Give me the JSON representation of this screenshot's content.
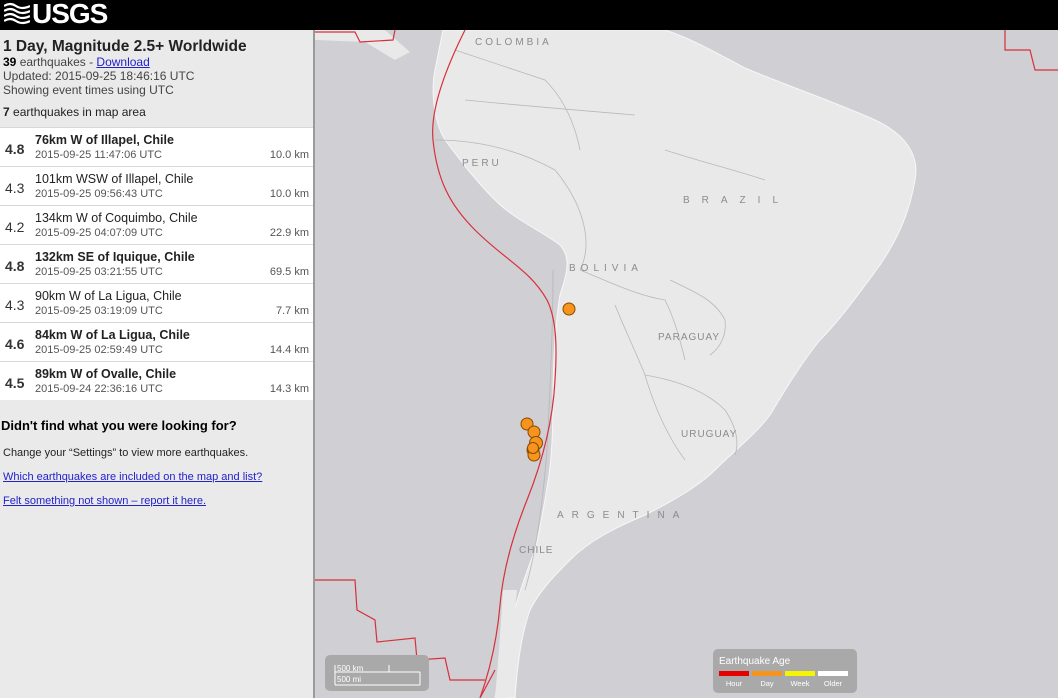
{
  "header": {
    "logo_text": "USGS"
  },
  "summary": {
    "title": "1 Day, Magnitude 2.5+ Worldwide",
    "count": "39",
    "count_suffix": " earthquakes - ",
    "download_label": "Download",
    "updated": "Updated: 2015-09-25 18:46:16 UTC",
    "timezone_note": "Showing event times using UTC",
    "map_count": "7",
    "map_count_suffix": " earthquakes in map area"
  },
  "earthquakes": [
    {
      "mag": "4.8",
      "place": "76km W of Illapel, Chile",
      "time": "2015-09-25 11:47:06 UTC",
      "depth": "10.0 km"
    },
    {
      "mag": "4.3",
      "place": "101km WSW of Illapel, Chile",
      "time": "2015-09-25 09:56:43 UTC",
      "depth": "10.0 km"
    },
    {
      "mag": "4.2",
      "place": "134km W of Coquimbo, Chile",
      "time": "2015-09-25 04:07:09 UTC",
      "depth": "22.9 km"
    },
    {
      "mag": "4.8",
      "place": "132km SE of Iquique, Chile",
      "time": "2015-09-25 03:21:55 UTC",
      "depth": "69.5 km"
    },
    {
      "mag": "4.3",
      "place": "90km W of La Ligua, Chile",
      "time": "2015-09-25 03:19:09 UTC",
      "depth": "7.7 km"
    },
    {
      "mag": "4.6",
      "place": "84km W of La Ligua, Chile",
      "time": "2015-09-25 02:59:49 UTC",
      "depth": "14.4 km"
    },
    {
      "mag": "4.5",
      "place": "89km W of Ovalle, Chile",
      "time": "2015-09-24 22:36:16 UTC",
      "depth": "14.3 km"
    }
  ],
  "help": {
    "title": "Didn't find what you were looking for?",
    "settings_note": "Change your “Settings” to view more earthquakes.",
    "link_included": "Which earthquakes are included on the map and list?",
    "link_report": "Felt something not shown – report it here."
  },
  "map": {
    "labels": {
      "colombia": "COLOMBIA",
      "peru": "PERU",
      "brazil": "BRAZIL",
      "bolivia": "BOLIVIA",
      "paraguay": "PARAGUAY",
      "uruguay": "URUGUAY",
      "argentina": "ARGENTINA",
      "chile": "CHILE"
    },
    "colors": {
      "ocean": "#cfcfd4",
      "land": "#e9e9e9",
      "plate_boundary": "#d8303a",
      "marker": "#f7941d",
      "marker_stroke": "#8a4a00"
    },
    "scale": {
      "km": "500 km",
      "mi": "500 mi"
    },
    "legend": {
      "title": "Earthquake Age",
      "items": [
        {
          "label": "Hour",
          "color": "#e60000"
        },
        {
          "label": "Day",
          "color": "#f7941d"
        },
        {
          "label": "Week",
          "color": "#f5f500"
        },
        {
          "label": "Older",
          "color": "#ffffff"
        }
      ]
    }
  }
}
